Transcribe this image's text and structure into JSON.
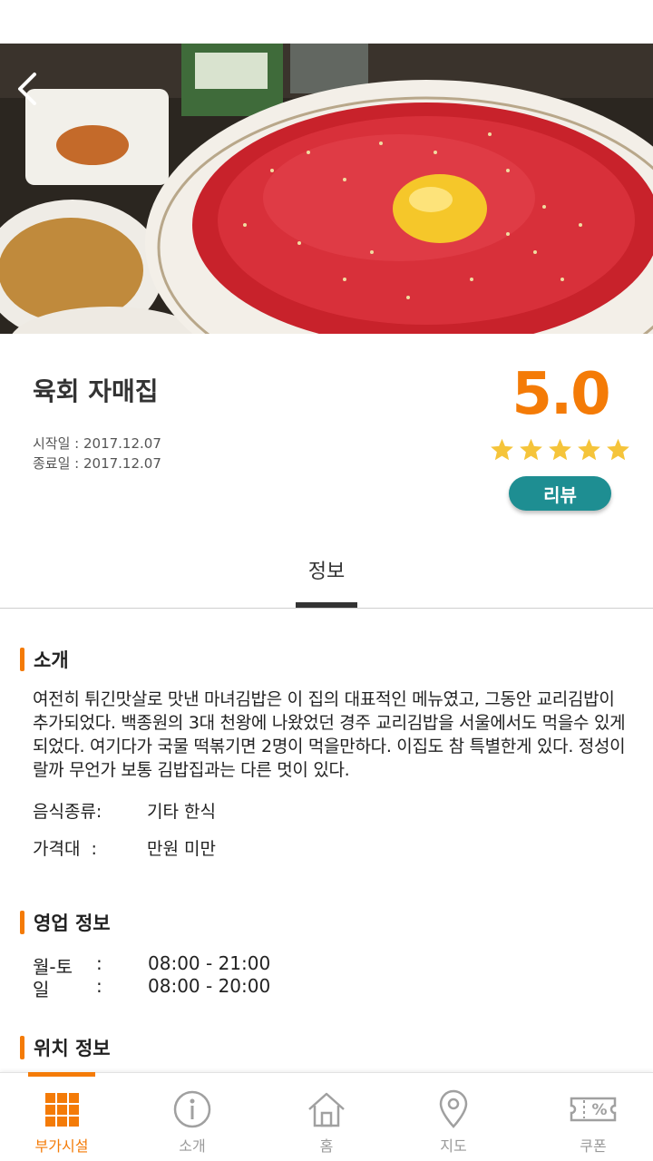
{
  "restaurant": {
    "name": "육회 자매집",
    "start_date": "시작일 : 2017.12.07",
    "end_date": "종료일 : 2017.12.07",
    "rating": "5.0",
    "stars": 5,
    "review_label": "리뷰"
  },
  "tabs": {
    "info": "정보"
  },
  "intro": {
    "title": "소개",
    "description": "여전히 튀긴맛살로 맛낸 마녀김밥은 이 집의 대표적인 메뉴였고, 그동안 교리김밥이 추가되었다. 백종원의 3대 천왕에 나왔었던 경주 교리김밥을 서울에서도 먹을수 있게 되었다. 여기다가 국물 떡볶기면 2명이 먹을만하다. 이집도 참 특별한게 있다. 정성이랄까 무언가 보통 김밥집과는 다른 멋이 있다.",
    "food_type_label": "음식종류:",
    "food_type_value": "기타 한식",
    "price_label": "가격대  :",
    "price_value": "만원 미만"
  },
  "hours": {
    "title": "영업 정보",
    "rows": [
      {
        "days": "월-토",
        "sep": ":",
        "time": "08:00 - 21:00"
      },
      {
        "days": "일",
        "sep": ":",
        "time": "08:00 - 20:00"
      }
    ]
  },
  "location": {
    "title": "위치 정보"
  },
  "bottom_nav": [
    {
      "label": "부가시설",
      "icon": "grid-icon",
      "active": true
    },
    {
      "label": "소개",
      "icon": "info-circle-icon",
      "active": false
    },
    {
      "label": "홈",
      "icon": "home-icon",
      "active": false
    },
    {
      "label": "지도",
      "icon": "map-pin-icon",
      "active": false
    },
    {
      "label": "쿠폰",
      "icon": "coupon-icon",
      "active": false
    }
  ],
  "colors": {
    "accent": "#f47b07",
    "review_button": "#1e8e92",
    "star": "#f5c43a"
  }
}
